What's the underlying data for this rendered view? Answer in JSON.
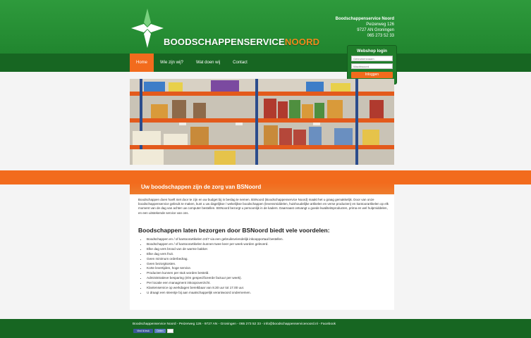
{
  "brand": {
    "name_main": "BOODSCHAPPENSERVICE",
    "name_accent": "NOORD"
  },
  "contact": {
    "company": "Boodschappenservice Noord",
    "street": "Peizerweg 126",
    "city": "9727 AN Groningen",
    "phone": "065 273 52 33"
  },
  "nav": [
    {
      "label": "Home",
      "active": true
    },
    {
      "label": "Wie zijn wij?",
      "active": false
    },
    {
      "label": "Wat doen wij",
      "active": false
    },
    {
      "label": "Contact",
      "active": false
    }
  ],
  "login": {
    "title": "Webshop login",
    "username_placeholder": "Gebruikersnaam",
    "password_placeholder": "Wachtwoord",
    "button": "Inloggen"
  },
  "content": {
    "title": "Uw boodschappen zijn de zorg van BSNoord",
    "intro": "Boodschappen doen hoeft niet door te zijn en uw budget bij in beslag te nemen. BSNoord (Boodschappenservice Noord) maakt het u graag gemakkelijk. Door van onze boodschappenservice gebruik te maken, kunt u uw dagelijkse / wekelijkse boodschappen (levensmiddelen, huishoudelijke artikelen en verse producten) en kantoorartikelen op elk moment van de dag van achter uw computer bestellen. BSNoord bezorgt u persoonlijk in de kaders. Daarnaast ontvangt u goede kwaliteitsproducten, prima en wel hulpmiddelen, en een uitstekende service van ons.",
    "subheading": "Boodschappen laten bezorgen door BSNoord biedt vele voordelen:",
    "bullets": [
      "Boodschappen en / of kantoorartikelen 24/7 via een gebruiksvriendelijk inkoopportaal bestellen.",
      "Boodschappen en / of kantoorartikelen kunnen twee keer per week worden geleverd.",
      "Elke dag vers brood van de warme bakker.",
      "Elke dag vers fruit.",
      "Geen minimum orderbedrag.",
      "Geen bezorgkosten.",
      "Korte levertijden, hoge service.",
      "Producten kunnen per stuk worden besteld.",
      "Administratieve besparing (één gespecificeerde factuur per week).",
      "Per locatie een managment inkoopoverzicht.",
      "Klantenservice op werkdagen bereikbaar van 8.30 uur tot 17.00 uur.",
      "U draagt een steentje bij aan maatschappelijk verantwoord ondernemen."
    ]
  },
  "footer": {
    "text": "Boodschappenservice Noord - Peizerweg 126 - 9727 AN - Groningen - 065 273 52 33 - info@boodschappenservicenoord.nl - Facebook",
    "like_label": "Vind ik leuk",
    "share_label": "Delen"
  },
  "colors": {
    "green": "#21862f",
    "dark_green": "#176622",
    "orange": "#f26b1d"
  }
}
